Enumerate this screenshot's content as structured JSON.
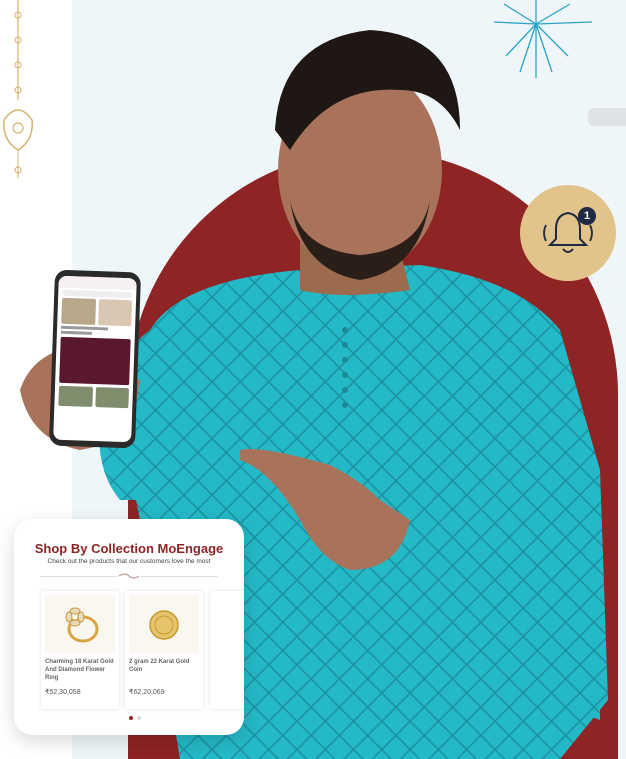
{
  "shop": {
    "title": "Shop By Collection MoEngage",
    "subtitle": "Check out the products that our customers love the most",
    "products": [
      {
        "name": "Charming 18 Karat Gold And Diamond Flower Ring",
        "price": "₹52,30,058"
      },
      {
        "name": "2 gram 22 Karat Gold Coin",
        "price": "₹62,20,069"
      },
      {
        "name": "",
        "price": ""
      }
    ],
    "pagination": {
      "total": 2,
      "active": 1
    }
  },
  "notification": {
    "count": "1",
    "icon": "bell-icon"
  },
  "colors": {
    "accent": "#8e2424",
    "badge": "#e2c48b",
    "background": "#eef6f9",
    "kurta": "#1fb8c4"
  }
}
